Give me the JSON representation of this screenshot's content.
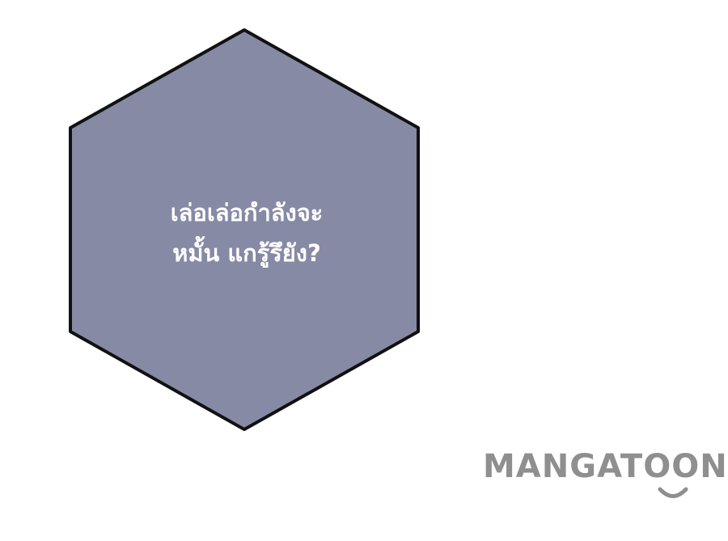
{
  "speech_bubble": {
    "shape": "hexagon",
    "fill_color": "#878aa5",
    "border_color": "#111111",
    "text_color": "#ffffff",
    "lines": [
      "เล่อเล่อกำลังจะ",
      "หมั้น แกรู้รึยัง?"
    ]
  },
  "watermark": {
    "text": "MANGATOON",
    "color": "#8f8f8f"
  }
}
